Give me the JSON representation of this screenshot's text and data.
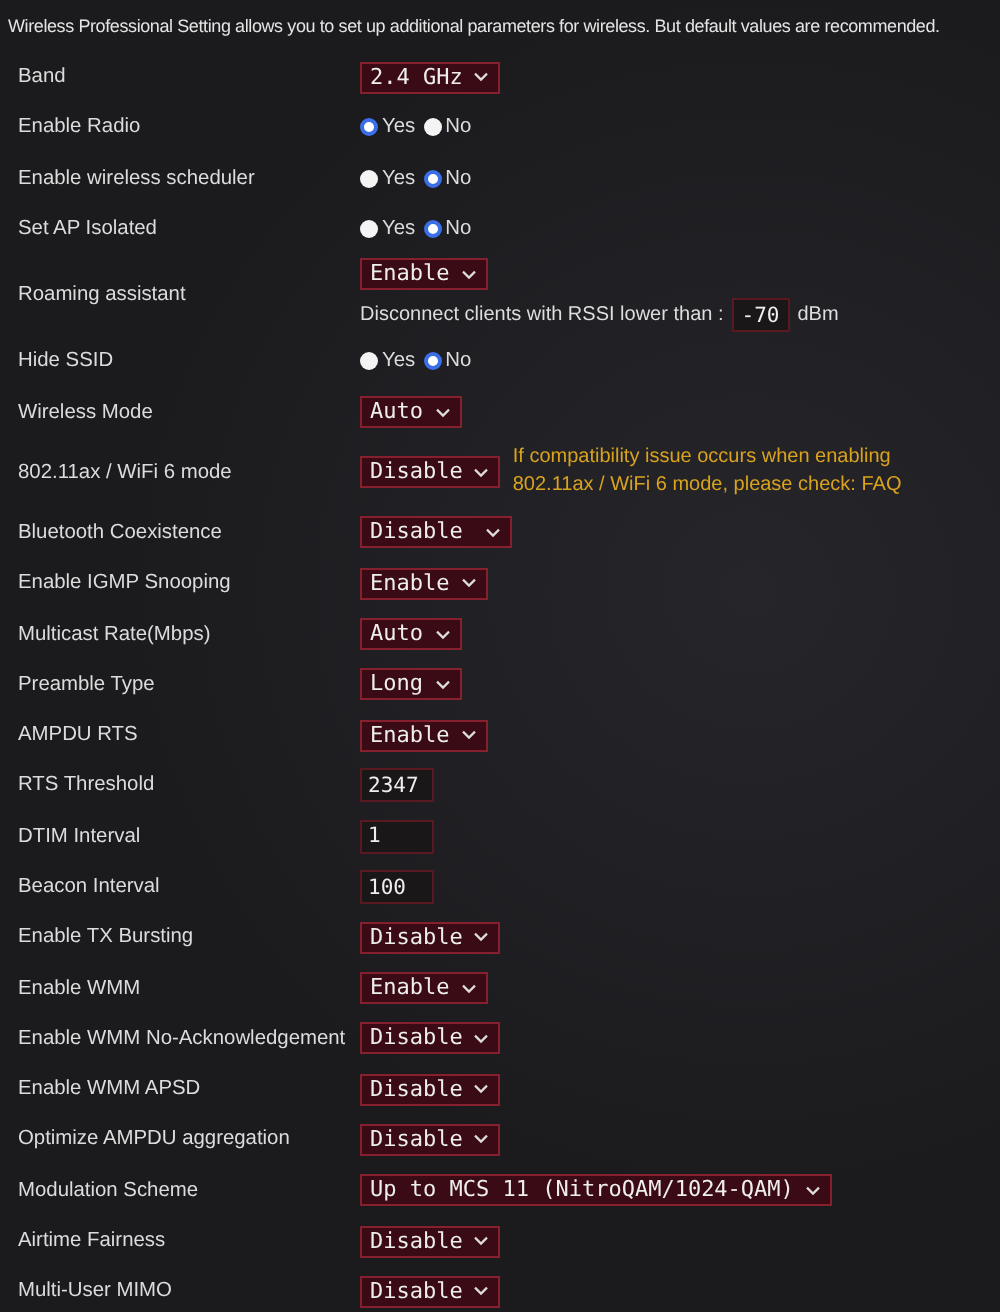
{
  "intro": "Wireless Professional Setting allows you to set up additional parameters for wireless. But default values are recommended.",
  "rows": [
    {
      "label": "Band",
      "kind": "select",
      "value": "2.4 GHz"
    },
    {
      "label": "Enable Radio",
      "kind": "radio",
      "options": [
        {
          "label": "Yes",
          "selected": true
        },
        {
          "label": "No",
          "selected": false
        }
      ]
    },
    {
      "label": "Enable wireless scheduler",
      "kind": "radio",
      "options": [
        {
          "label": "Yes",
          "selected": false
        },
        {
          "label": "No",
          "selected": true
        }
      ]
    },
    {
      "label": "Set AP Isolated",
      "kind": "radio",
      "options": [
        {
          "label": "Yes",
          "selected": false
        },
        {
          "label": "No",
          "selected": true
        }
      ]
    },
    {
      "label": "Roaming assistant",
      "kind": "select",
      "value": "Enable",
      "extra": {
        "text": "Disconnect clients with RSSI lower than :",
        "value": "-70",
        "unit": "dBm"
      }
    },
    {
      "label": "Hide SSID",
      "kind": "radio",
      "options": [
        {
          "label": "Yes",
          "selected": false
        },
        {
          "label": "No",
          "selected": true
        }
      ]
    },
    {
      "label": "Wireless Mode",
      "kind": "select",
      "value": "Auto"
    },
    {
      "label": "802.11ax / WiFi 6 mode",
      "kind": "select",
      "value": "Disable",
      "note": "If compatibility issue occurs when enabling 802.11ax / WiFi 6 mode, please check:",
      "link": "FAQ"
    },
    {
      "label": "Bluetooth Coexistence",
      "kind": "select",
      "value": "Disable",
      "wide": true
    },
    {
      "label": "Enable IGMP Snooping",
      "kind": "select",
      "value": "Enable"
    },
    {
      "label": "Multicast Rate(Mbps)",
      "kind": "select",
      "value": "Auto"
    },
    {
      "label": "Preamble Type",
      "kind": "select",
      "value": "Long"
    },
    {
      "label": "AMPDU RTS",
      "kind": "select",
      "value": "Enable"
    },
    {
      "label": "RTS Threshold",
      "kind": "text",
      "value": "2347"
    },
    {
      "label": "DTIM Interval",
      "kind": "text",
      "value": "1"
    },
    {
      "label": "Beacon Interval",
      "kind": "text",
      "value": "100"
    },
    {
      "label": "Enable TX Bursting",
      "kind": "select",
      "value": "Disable"
    },
    {
      "label": "Enable WMM",
      "kind": "select",
      "value": "Enable"
    },
    {
      "label": "Enable WMM No-Acknowledgement",
      "kind": "select",
      "value": "Disable"
    },
    {
      "label": "Enable WMM APSD",
      "kind": "select",
      "value": "Disable"
    },
    {
      "label": "Optimize AMPDU aggregation",
      "kind": "select",
      "value": "Disable"
    },
    {
      "label": "Modulation Scheme",
      "kind": "select",
      "value": "Up to MCS 11 (NitroQAM/1024-QAM)"
    },
    {
      "label": "Airtime Fairness",
      "kind": "select",
      "value": "Disable"
    },
    {
      "label": "Multi-User MIMO",
      "kind": "select",
      "value": "Disable"
    }
  ]
}
